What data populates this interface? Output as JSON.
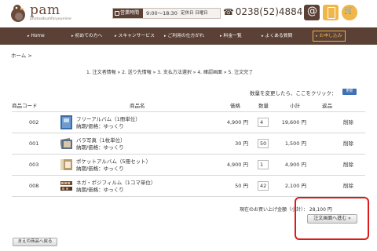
{
  "header": {
    "logo_text": "pam",
    "logo_sub": "photoalbumforyoumine",
    "hours_tag": "営業時間",
    "hours_time": "9:00～18:30",
    "hours_closed": "定休日 日曜日",
    "phone": "0238(52)4884",
    "icons": [
      "mail-icon",
      "mobile-icon",
      "cart-icon"
    ]
  },
  "nav": {
    "items": [
      {
        "label": "Home"
      },
      {
        "label": "初めての方へ"
      },
      {
        "label": "スキャンサービス"
      },
      {
        "label": "ご利用の仕方がれ"
      },
      {
        "label": "料金一覧"
      },
      {
        "label": "よくある質問"
      },
      {
        "label": "お申し込み"
      }
    ]
  },
  "breadcrumb": "ホーム >",
  "steps": "1. 注文者情報 »  2. 送り先情報 »  3. 支払方法選択 »  4. 確認画面 »  5. 注文完了",
  "qty_note": "数量を変更したら、ここをクリック：",
  "update_label": "更新",
  "table": {
    "headers": {
      "code": "商品コード",
      "name": "商品名",
      "price": "価格",
      "qty": "数量",
      "subtotal": "小計",
      "return": "返品"
    },
    "rows": [
      {
        "code": "002",
        "name": "フリーアルバム（1冊単位）",
        "delivery": "納期/価格：ゆっくり",
        "price": "4,900 円",
        "qty": "4",
        "subtotal": "19,600 円",
        "delete": "削除"
      },
      {
        "code": "001",
        "name": "バラ写真（1枚単位）",
        "delivery": "納期/価格：ゆっくり",
        "price": "30 円",
        "qty": "50",
        "subtotal": "1,500 円",
        "delete": "削除"
      },
      {
        "code": "003",
        "name": "ポケットアルバム（5冊セット）",
        "delivery": "納期/価格：ゆっくり",
        "price": "4,900 円",
        "qty": "1",
        "subtotal": "4,900 円",
        "delete": "削除"
      },
      {
        "code": "008",
        "name": "ネガ・ポジフィルム（1コマ単位）",
        "delivery": "納期/価格：ゆっくり",
        "price": "50 円",
        "qty": "42",
        "subtotal": "2,100 円",
        "delete": "削除"
      }
    ]
  },
  "total": "現在のお買い上げ金額（小計）： 28,100 円",
  "order_button": "注文画面へ進む »",
  "back_button": "まえの商品へ戻る",
  "colors": {
    "brand_brown": "#5a4035",
    "accent_orange": "#f0b64a",
    "highlight_red": "#e01818"
  }
}
